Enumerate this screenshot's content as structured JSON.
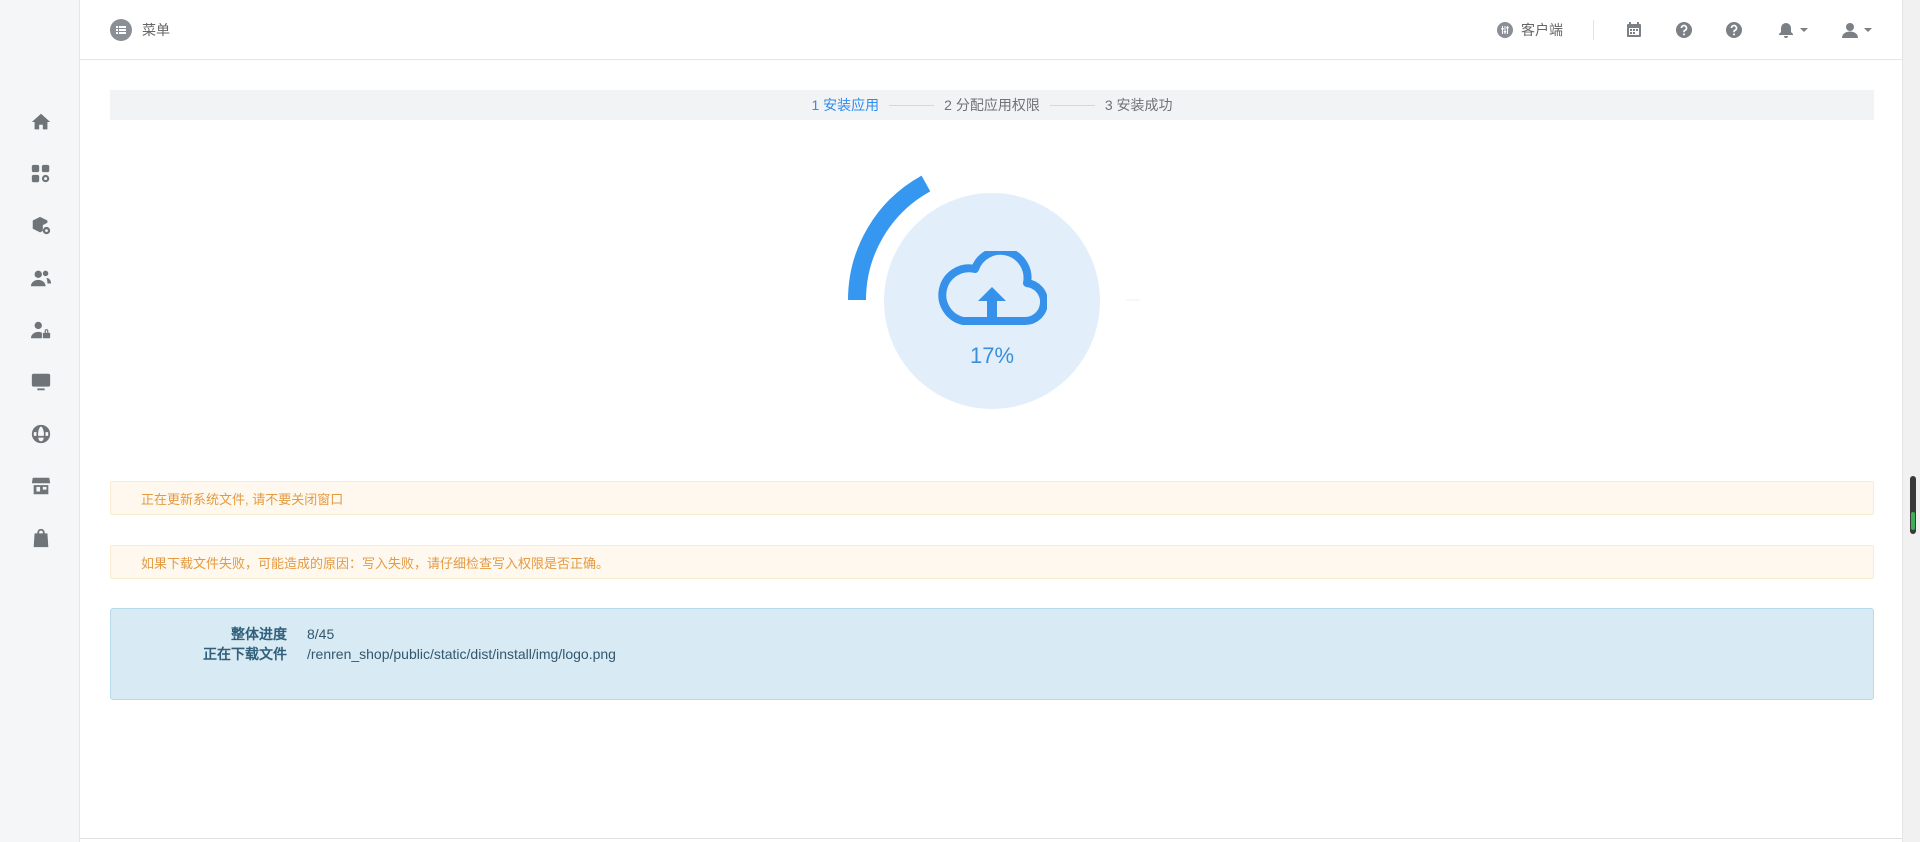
{
  "header": {
    "menu_label": "菜单",
    "client_label": "客户端",
    "icons": [
      "calendar-icon",
      "help-icon",
      "help-icon",
      "bell-icon",
      "user-icon"
    ]
  },
  "sidebar": {
    "items": [
      "home-icon",
      "apps-settings-icon",
      "package-settings-icon",
      "users-icon",
      "user-lock-icon",
      "monitor-icon",
      "globe-icon",
      "store-icon",
      "bag-icon"
    ]
  },
  "steps": [
    {
      "label": "1 安装应用",
      "active": true
    },
    {
      "label": "2 分配应用权限",
      "active": false
    },
    {
      "label": "3 安装成功",
      "active": false
    }
  ],
  "progress": {
    "percent_text": "17%",
    "value": 0.17,
    "color": "#3597f0"
  },
  "alerts": [
    "正在更新系统文件, 请不要关闭窗口",
    "如果下载文件失败，可能造成的原因：写入失败，请仔细检查写入权限是否正确。"
  ],
  "info": {
    "overall_label": "整体进度",
    "overall_value": "8/45",
    "downloading_label": "正在下载文件",
    "downloading_value": "/renren_shop/public/static/dist/install/img/logo.png"
  }
}
